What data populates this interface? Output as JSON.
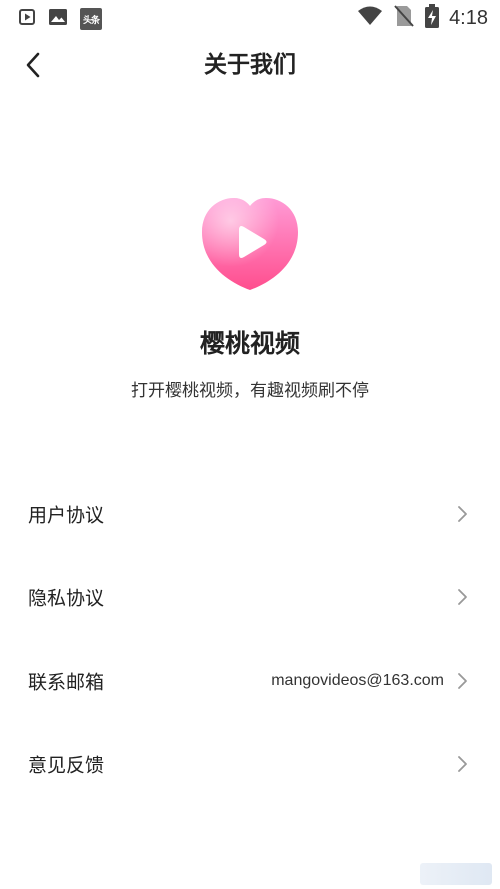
{
  "status_bar": {
    "time": "4:18",
    "left_icons": [
      "play-box-icon",
      "image-icon",
      "toutiao-app-icon"
    ],
    "app_badge_text": "头条",
    "right_icons": [
      "wifi-icon",
      "no-sim-icon",
      "battery-charging-icon"
    ]
  },
  "header": {
    "title": "关于我们",
    "back_icon": "chevron-left-icon"
  },
  "app": {
    "name": "樱桃视频",
    "slogan": "打开樱桃视频，有趣视频刷不停",
    "logo_colors": {
      "heart_top": "#ff8fd0",
      "heart_bottom": "#ff4f8f",
      "play": "#ffffff"
    }
  },
  "menu": {
    "items": [
      {
        "label": "用户协议",
        "value": ""
      },
      {
        "label": "隐私协议",
        "value": ""
      },
      {
        "label": "联系邮箱",
        "value": "mangovideos@163.com"
      },
      {
        "label": "意见反馈",
        "value": ""
      }
    ]
  }
}
